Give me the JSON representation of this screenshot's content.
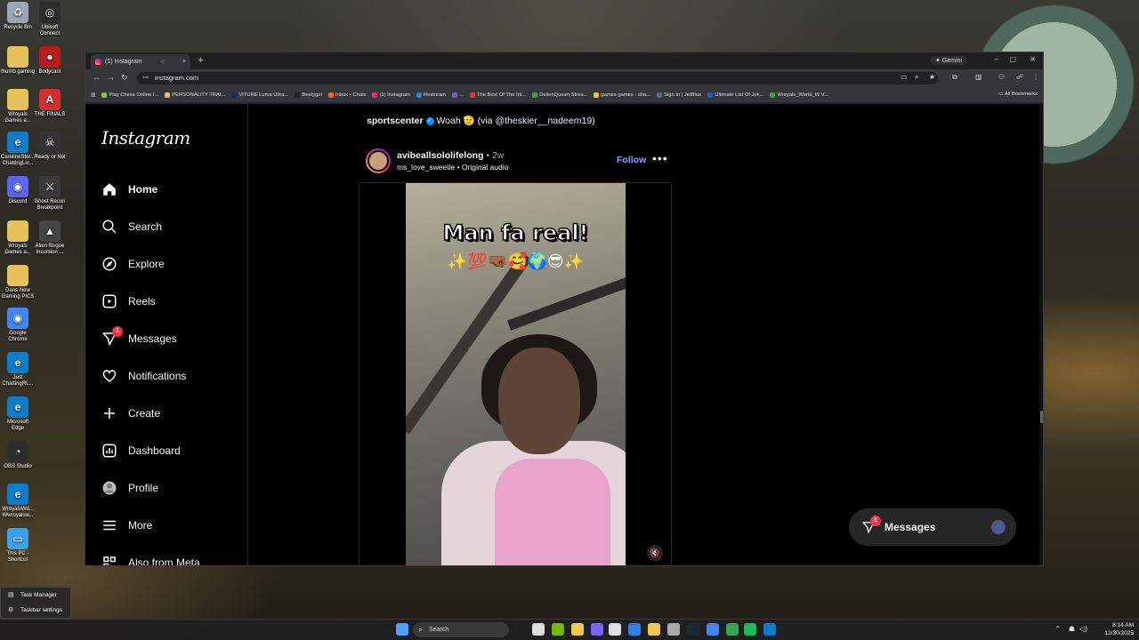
{
  "desktop": {
    "icons": [
      {
        "label": "Recycle Bin",
        "color": "#9aa6b5",
        "glyph": "♻"
      },
      {
        "label": "Ubisoft Connect",
        "color": "#2d2d2d",
        "glyph": "◎"
      },
      {
        "label": "thumb gaming",
        "color": "#e6c15c",
        "glyph": ""
      },
      {
        "label": "Bodycam",
        "color": "#b71c1c",
        "glyph": "●"
      },
      {
        "label": "Wroyals Games a...",
        "color": "#e6c15c",
        "glyph": ""
      },
      {
        "label": "THE FINALS",
        "color": "#d32f2f",
        "glyph": "A"
      },
      {
        "label": "CarolineStor... ChattingLiv...",
        "color": "#0f7cc9",
        "glyph": "e"
      },
      {
        "label": "Ready or Not",
        "color": "#333",
        "glyph": "☠"
      },
      {
        "label": "Discord",
        "color": "#5865f2",
        "glyph": "◉"
      },
      {
        "label": "Ghost Recon Breakpoint",
        "color": "#3a3a3a",
        "glyph": "⚔"
      },
      {
        "label": "Wroyals Games a...",
        "color": "#e6c15c",
        "glyph": ""
      },
      {
        "label": "Alien Rogue Incursion ...",
        "color": "#444",
        "glyph": "▲"
      },
      {
        "label": "Dans New Gaming PICS",
        "color": "#e6c15c",
        "glyph": ""
      },
      {
        "label": "Google Chrome",
        "color": "#4285f4",
        "glyph": "◉"
      },
      {
        "label": "Just ChattingRL...",
        "color": "#0f7cc9",
        "glyph": "e"
      },
      {
        "label": "Microsoft Edge",
        "color": "#0f7cc9",
        "glyph": "e"
      },
      {
        "label": "OBS Studio",
        "color": "#2d2d2d",
        "glyph": "◔"
      },
      {
        "label": "WroyalsWd... Wwroyalsw...",
        "color": "#0f7cc9",
        "glyph": "e"
      },
      {
        "label": "This PC - Shortcut",
        "color": "#3aa0e8",
        "glyph": "▭"
      }
    ]
  },
  "browser": {
    "tab_title": "(1) Instagram",
    "tab_close": "×",
    "new_tab": "+",
    "gemini_label": "✦ Gemini",
    "url": "instagram.com",
    "window_controls": {
      "minimize": "–",
      "maximize": "▢",
      "close": "✕"
    },
    "bookmarks": [
      {
        "label": "Play Chess Online f...",
        "color": "#8bc34a"
      },
      {
        "label": "PERSONALITY TRAI...",
        "color": "#e6c15c"
      },
      {
        "label": "VITURE Luma Ultra...",
        "color": "#1a237e"
      },
      {
        "label": "Beetygirl",
        "color": "#222"
      },
      {
        "label": "Inbox • Chats",
        "color": "#ff6d00"
      },
      {
        "label": "(1) Instagram",
        "color": "#ee2a7b"
      },
      {
        "label": "Restream",
        "color": "#1e88e5"
      },
      {
        "label": "...",
        "color": "#7e57c2"
      },
      {
        "label": "The Best Of The Int...",
        "color": "#e53935"
      },
      {
        "label": "DeilenQueen Strea...",
        "color": "#43a047"
      },
      {
        "label": "games games - sha...",
        "color": "#fbc02d"
      },
      {
        "label": "Sign In | JetBlue",
        "color": "#546e7a"
      },
      {
        "label": "Ultimate List Of Jok...",
        "color": "#1565c0"
      },
      {
        "label": "Wroyals_World_W V...",
        "color": "#43a047"
      }
    ],
    "all_bookmarks": "All Bookmarks"
  },
  "instagram": {
    "logo": "Instagram",
    "nav": [
      {
        "label": "Home",
        "icon": "home-icon",
        "active": true
      },
      {
        "label": "Search",
        "icon": "search-icon"
      },
      {
        "label": "Explore",
        "icon": "explore-icon"
      },
      {
        "label": "Reels",
        "icon": "reels-icon"
      },
      {
        "label": "Messages",
        "icon": "messages-icon",
        "badge": "1"
      },
      {
        "label": "Notifications",
        "icon": "heart-icon"
      },
      {
        "label": "Create",
        "icon": "plus-icon"
      },
      {
        "label": "Dashboard",
        "icon": "dashboard-icon"
      },
      {
        "label": "Profile",
        "icon": "profile-avatar-icon"
      },
      {
        "label": "More",
        "icon": "menu-icon"
      },
      {
        "label": "Also from Meta",
        "icon": "meta-icon"
      }
    ],
    "previous_caption": {
      "user": "sportscenter",
      "text": " Woah 🫡 (via ",
      "mention": "@theskier__nadeem19",
      "close": ")"
    },
    "post": {
      "username": "avibeallsololifelong",
      "time": " • 2w",
      "audio_user": "ms_love_sweetie",
      "audio_sep": " • ",
      "audio": "Original audio",
      "follow_label": "Follow",
      "more_label": "•••",
      "overlay_text": "Man fa real!",
      "overlay_emoji": "✨💯🤜🏾🥰🌍😎✨",
      "mute_icon": "🔇"
    },
    "messages_pill": {
      "label": "Messages",
      "badge": "1"
    }
  },
  "taskbar": {
    "search_placeholder": "Search",
    "time": "8:14 AM",
    "date": "12/30/2025",
    "context_menu": [
      {
        "label": "Task Manager",
        "icon": "task-manager-icon"
      },
      {
        "label": "Taskbar settings",
        "icon": "settings-icon"
      }
    ],
    "apps": [
      {
        "name": "start-icon",
        "color": "#4aa3ff"
      },
      {
        "name": "widgets-icon",
        "color": "#8aa"
      },
      {
        "name": "task-view-icon",
        "color": "#ddd"
      },
      {
        "name": "nvidia-icon",
        "color": "#76b900"
      },
      {
        "name": "explorer-icon",
        "color": "#f2c94c"
      },
      {
        "name": "copilot-icon",
        "color": "#7b61ff"
      },
      {
        "name": "notepad-icon",
        "color": "#e0e0e0"
      },
      {
        "name": "store-icon",
        "color": "#2f80ed"
      },
      {
        "name": "folder-icon",
        "color": "#f2c94c"
      },
      {
        "name": "settings-icon",
        "color": "#aaa"
      },
      {
        "name": "steam-icon",
        "color": "#1b2838"
      },
      {
        "name": "chrome-icon",
        "color": "#4285f4"
      },
      {
        "name": "chrome-alt-icon",
        "color": "#34a853"
      },
      {
        "name": "spotify-icon",
        "color": "#1db954"
      },
      {
        "name": "edge-icon",
        "color": "#0f7cc9"
      }
    ]
  }
}
